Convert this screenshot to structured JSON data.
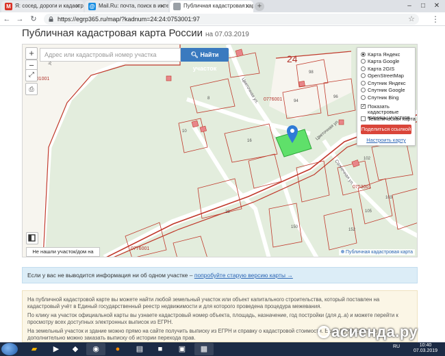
{
  "browser": {
    "tabs": [
      {
        "icon": "gmail-icon",
        "label": "Я: сосед, дороги и кадастровые",
        "active": false
      },
      {
        "icon": "mailru-icon",
        "label": "Mail.Ru: почта, поиск в интернет",
        "active": false
      },
      {
        "icon": "page-icon",
        "label": "Публичная кадастровая карта",
        "active": true
      }
    ],
    "url": "https://egrp365.ru/map/?kadnum=24:24:0753001:97"
  },
  "page": {
    "title": "Публичная кадастровая карта России",
    "date": "на 07.03.2019"
  },
  "map": {
    "search_placeholder": "Адрес или кадастровый номер участка",
    "search_button": "Найти участок",
    "zoom_in": "+",
    "zoom_out": "−",
    "layers": [
      {
        "label": "Карта Яндекс",
        "selected": true
      },
      {
        "label": "Карта Google",
        "selected": false
      },
      {
        "label": "Карта 2GIS",
        "selected": false
      },
      {
        "label": "OpenStreetMap",
        "selected": false
      },
      {
        "label": "Спутник Яндекс",
        "selected": false
      },
      {
        "label": "Спутник Google",
        "selected": false
      },
      {
        "label": "Спутник Bing",
        "selected": false
      }
    ],
    "show_boundaries_label": "Показать кадастровые границы участков",
    "show_boundaries_checked": true,
    "thematic_label": "Тематическая карта",
    "thematic_checked": false,
    "share_button": "Поделиться ссылкой",
    "setup_link": "Настроить карту",
    "not_found_button": "Не нашли участок/дом на карте?",
    "copyright": "Публичная кадастровая карта",
    "labels": {
      "quarter_24": "24",
      "block_0776001_a": "0776001",
      "block_0776001_b": "0776001",
      "block_0776001_c": "0776001",
      "block_0753001": "0753001",
      "block_0701001": "0701001",
      "street_1": "Цветочная ул.",
      "street_2": "Цветочная ул.",
      "street_3": "Солнечная ул.",
      "street_4": "ул. Сосн",
      "plot_8": "8",
      "plot_10": "10",
      "plot_16": "16",
      "plot_23": "23",
      "plot_150": "150",
      "plot_152": "152",
      "plot_103": "103",
      "plot_105": "105",
      "plot_102": "102",
      "plot_94": "94",
      "plot_96": "96",
      "plot_98": "98"
    },
    "colors": {
      "selected_plot": "#5fe06a",
      "boundary": "#c0392b",
      "marker": "#2e7bd6"
    }
  },
  "info_bar": {
    "text": "Если у вас не выводится информация ни об одном участке –",
    "link": "попробуйте старую версию карты →"
  },
  "description": {
    "p1": "На публичной кадастровой карте вы можете найти любой земельный участок или объект капитального строительства, который поставлен на кадастровый учёт в Единый государственный реестр недвижимости и для которого проведена процедура межевания.",
    "p2": "По клику на участок официальной карты вы узнаете кадастровый номер объекта, площадь, назначение, год постройки (для д..а) и можете перейти к просмотру всех доступных электронных выписок из ЕГРН.",
    "p3": "На земельный участок и здание можно прямо на сайте получить выписку из ЕГРН и справку о кадастровой стоимости. Есл... ЕГРП/ЕГРН, то дополнительно можно заказать выписку об истории перехода прав."
  },
  "watermark": "асиенда.ру",
  "taskbar": {
    "lang": "RU",
    "time": "10:40",
    "date": "07.03.2019"
  }
}
